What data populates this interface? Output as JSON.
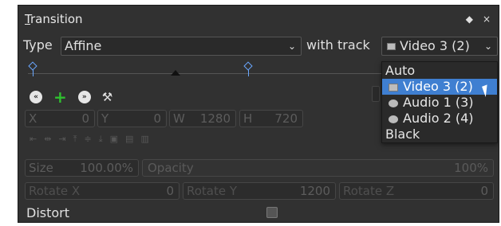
{
  "panel": {
    "title": "Transition",
    "title_first": "T",
    "title_rest": "ransition",
    "pin_icon": "diamond-icon",
    "close_glyph": "×"
  },
  "type_row": {
    "type_label": "Type",
    "type_value": "Affine",
    "with_track_label": "with track",
    "track_value": "Video 3 (2)"
  },
  "track_dropdown": {
    "options": [
      {
        "label": "Auto",
        "icon": "",
        "selected": false
      },
      {
        "label": "Video 3 (2)",
        "icon": "film-icon",
        "selected": true
      },
      {
        "label": "Audio 1 (3)",
        "icon": "speaker-icon",
        "selected": false
      },
      {
        "label": "Audio 2 (4)",
        "icon": "speaker-icon",
        "selected": false
      },
      {
        "label": "Black",
        "icon": "",
        "selected": false
      }
    ]
  },
  "geometry": {
    "x_label": "X",
    "x_value": "0",
    "y_label": "Y",
    "y_value": "0",
    "w_label": "W",
    "w_value": "1280",
    "h_label": "H",
    "h_value": "720"
  },
  "size_row": {
    "size_label": "Size",
    "size_value": "100.00%",
    "opacity_label": "Opacity",
    "opacity_value": "100%"
  },
  "rotate_row": {
    "rx_label": "Rotate X",
    "rx_value": "0",
    "ry_label": "Rotate Y",
    "ry_value": "1200",
    "rz_label": "Rotate Z",
    "rz_value": "0"
  },
  "distort_label": "Distort",
  "colors": {
    "panel_bg": "#313131",
    "accent": "#3f7fd1",
    "keyframe": "#6aa7ff",
    "add_green": "#2fc12f"
  }
}
